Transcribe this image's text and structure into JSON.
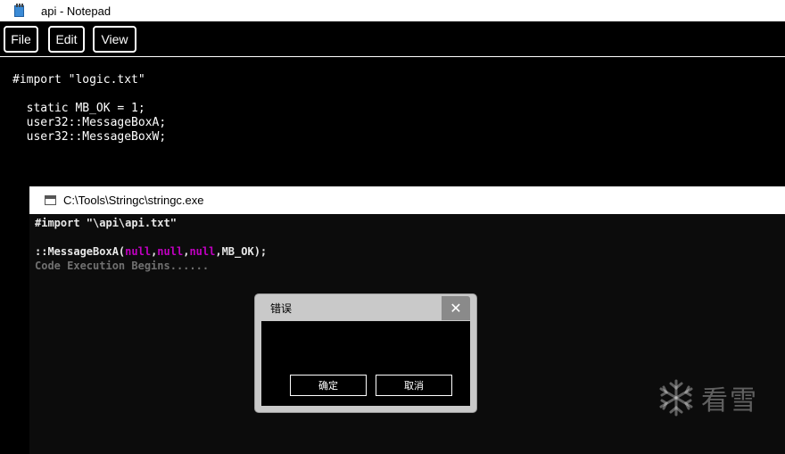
{
  "notepad": {
    "title": "api - Notepad",
    "menu": [
      "File",
      "Edit",
      "View"
    ],
    "lines": [
      "#import \"logic.txt\"",
      "",
      "  static MB_OK = 1;",
      "  user32::MessageBoxA;",
      "  user32::MessageBoxW;"
    ]
  },
  "console": {
    "title": "C:\\Tools\\Stringc\\stringc.exe",
    "line1": "#import \"\\api\\api.txt\"",
    "line2_prefix": "::MessageBoxA(",
    "kw": "null",
    "comma": ",",
    "line2_suffix": "MB_OK);",
    "line3": "Code Execution Begins......"
  },
  "dialog": {
    "title": "错误",
    "close_glyph": "✕",
    "ok_label": "确定",
    "cancel_label": "取消"
  },
  "watermark": {
    "text": "看雪",
    "icon": "snowflake-icon"
  },
  "colors": {
    "keyword": "#c000c0",
    "console_bg": "#0c0c0c",
    "status_gray": "#707070"
  }
}
